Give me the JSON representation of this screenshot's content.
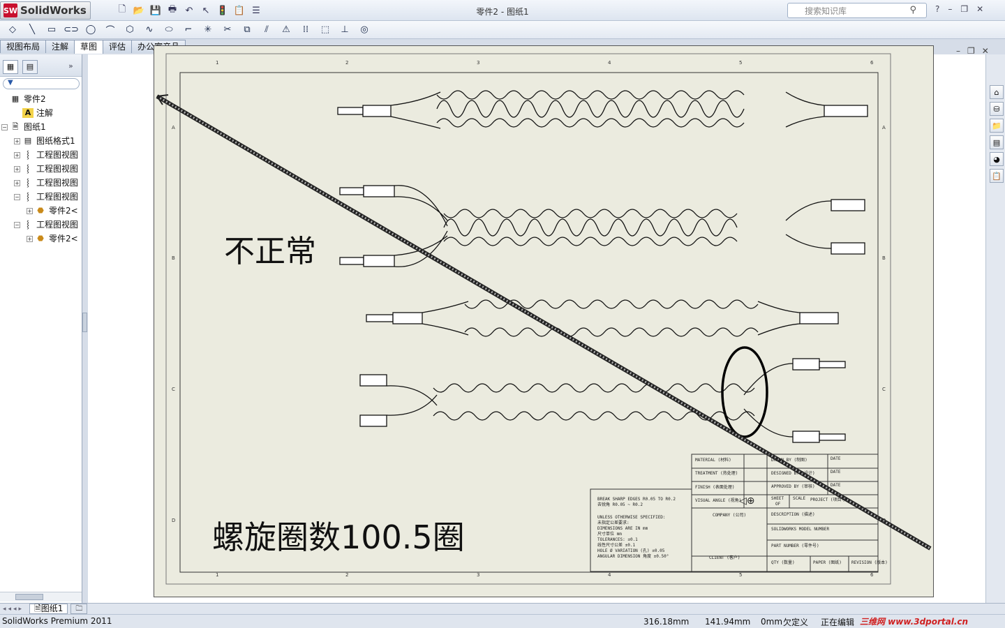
{
  "app": {
    "name": "SolidWorks",
    "document_title": "零件2 - 图纸1"
  },
  "search": {
    "placeholder": "搜索知识库"
  },
  "window_buttons": [
    "?",
    "–",
    "❐",
    "✕"
  ],
  "tabs": [
    {
      "label": "视图布局",
      "active": false
    },
    {
      "label": "注解",
      "active": false
    },
    {
      "label": "草图",
      "active": true
    },
    {
      "label": "评估",
      "active": false
    },
    {
      "label": "办公室产品",
      "active": false
    }
  ],
  "tree": [
    {
      "label": "零件2",
      "icon": "drawing-icon",
      "indent": 0,
      "expander": ""
    },
    {
      "label": "注解",
      "icon": "annotation-icon",
      "indent": 1,
      "expander": ""
    },
    {
      "label": "图纸1",
      "icon": "sheet-icon",
      "indent": 0,
      "expander": "−"
    },
    {
      "label": "图纸格式1",
      "icon": "sheet-format-icon",
      "indent": 1,
      "expander": "+"
    },
    {
      "label": "工程图视图",
      "icon": "drawing-view-icon",
      "indent": 1,
      "expander": "+"
    },
    {
      "label": "工程图视图",
      "icon": "drawing-view-icon",
      "indent": 1,
      "expander": "+"
    },
    {
      "label": "工程图视图",
      "icon": "drawing-view-icon",
      "indent": 1,
      "expander": "+"
    },
    {
      "label": "工程图视图",
      "icon": "drawing-view-icon",
      "indent": 1,
      "expander": "−"
    },
    {
      "label": "零件2<",
      "icon": "part-icon",
      "indent": 2,
      "expander": "+"
    },
    {
      "label": "工程图视图",
      "icon": "drawing-view-icon",
      "indent": 1,
      "expander": "−"
    },
    {
      "label": "零件2<",
      "icon": "part-icon",
      "indent": 2,
      "expander": "+"
    }
  ],
  "sheet_tab": {
    "label": "图纸1"
  },
  "status": {
    "product": "SolidWorks Premium 2011",
    "x": "316.18mm",
    "y": "141.94mm",
    "z": "0mm",
    "define_state": "欠定义",
    "editing": "正在编辑",
    "watermark": "三维网 www.3dportal.cn"
  },
  "annotations": {
    "abnormal": "不正常",
    "turns": "螺旋圈数100.5圈"
  },
  "drawing": {
    "zone_numbers": [
      "1",
      "2",
      "3",
      "4",
      "5",
      "6"
    ],
    "zone_letters": [
      "A",
      "B",
      "C",
      "D"
    ],
    "notes_block": [
      "UNLESS OTHERWISE SPECIFIED:",
      "未指定公差要求:",
      "DIMENSIONS ARE IN mm",
      "尺寸单位 mm",
      "TOLERANCES: ±0.1",
      "线性尺寸公差 ±0.1",
      "HOLE Ø VARIATION (孔) ±0.05",
      "ANGULAR DIMENSION 角度 ±0.50°"
    ],
    "break_edges": [
      "BREAK SHARP EDGES R0.05 TO R0.2",
      "去锐角 R0.05 ~ R0.2"
    ],
    "title_block": {
      "material": "MATERIAL (材料)",
      "treatment": "TREATMENT (热处理)",
      "finish": "FINISH (表面处理)",
      "visual_angle": "VISUAL ANGLE (视角)",
      "drawn_by": "DRAWN BY (制图)",
      "designed_by": "DESIGNED BY (设计)",
      "approved_by": "APPROVED BY (审核)",
      "date": "DATE",
      "sheet": "SHEET",
      "of": "OF",
      "scale": "SCALE",
      "project": "PROJECT (项目号)",
      "company": "COMPANY (公司)",
      "client": "CLIENT (客户)",
      "description": "DESCRIPTION (描述)",
      "model_number": "SOLIDWORKS MODEL NUMBER",
      "part_number": "PART NUMBER (零件号)",
      "qty": "QTY (数量)",
      "paper": "PAPER (图纸)",
      "revision": "REVISION (版本)"
    }
  }
}
